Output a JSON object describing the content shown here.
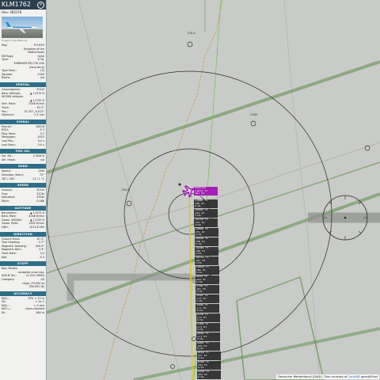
{
  "sidebar": {
    "callsign": "KLM1762",
    "hex_label": "Hex: 4852F8",
    "photo_caption": "Image © Jan Mazurek",
    "info_rows": [
      {
        "k": "Reg:",
        "v": "PH-EXH"
      },
      {
        "k": "",
        "v": "Kingdom of the"
      },
      {
        "k": "",
        "v": "Netherlands"
      },
      {
        "k": "DB flags:",
        "v": "none"
      },
      {
        "k": "Type:",
        "v": "E75L"
      },
      {
        "k": "",
        "v": "EMBRAER ERJ-170-200"
      },
      {
        "k": "",
        "v": "(long wing)"
      },
      {
        "k": "Type Desc.:",
        "v": "L2J"
      },
      {
        "k": "Squawk:",
        "v": "1000"
      },
      {
        "k": "Route:",
        "v": "n/a"
      }
    ],
    "sections": [
      {
        "title": "SPATIAL",
        "rows": [
          {
            "k": "Groundspeed:",
            "v": "301kt"
          },
          {
            "k": "Baro. Altitude:",
            "v": "▲ 11075 ft"
          },
          {
            "k": "WGS84 altitude:",
            "v": ""
          },
          {
            "k": "",
            "v": "▲ 11750 ft"
          },
          {
            "k": "Vert. Rate:",
            "v": "2048 ft/min"
          },
          {
            "k": "Track:",
            "v": "67.3°"
          },
          {
            "k": "Pos.:",
            "v": "51.207, 6.012°"
          },
          {
            "k": "Distance:",
            "v": "2.3 nmi"
          }
        ]
      },
      {
        "title": "SIGNAL",
        "rows": [
          {
            "k": "Source:",
            "v": "ADS-B"
          },
          {
            "k": "RSSI:",
            "v": "-5.2"
          },
          {
            "k": "Msg. Rate:",
            "v": "5.2"
          },
          {
            "k": "Messages:",
            "v": "2452"
          },
          {
            "k": "Last Pos.:",
            "v": "0.0 s"
          },
          {
            "k": "Last Seen:",
            "v": "0.0 s"
          }
        ]
      },
      {
        "title": "FMS SEL",
        "rows": [
          {
            "k": "Sel. Alt.:",
            "v": "17008 ft"
          },
          {
            "k": "Sel. Head.:",
            "v": "n/a"
          }
        ]
      },
      {
        "title": "WIND",
        "rows": [
          {
            "k": "Speed:",
            "v": "29kt"
          },
          {
            "k": "Direction (from):",
            "v": "73°"
          },
          {
            "k": "TAT / OAT:",
            "v": "11 / 1 °C"
          }
        ]
      },
      {
        "title": "SPEED",
        "rows": [
          {
            "k": "Ground:",
            "v": "301kt"
          },
          {
            "k": "True:",
            "v": "312kt"
          },
          {
            "k": "Indicated:",
            "v": "255kt"
          },
          {
            "k": "Mach:",
            "v": "0.486"
          }
        ]
      },
      {
        "title": "ALTITUDE",
        "rows": [
          {
            "k": "Barometric:",
            "v": "▲ 11075 ft"
          },
          {
            "k": "Baro. Rate:",
            "v": "2048 ft/min"
          },
          {
            "k": "Geom. WGS84:",
            "v": "▲ 11750 ft"
          },
          {
            "k": "Geom. Rate:",
            "v": "1632 ft/min"
          },
          {
            "k": "QNH:",
            "v": "1013.6 hPa"
          }
        ]
      },
      {
        "title": "DIRECTION",
        "rows": [
          {
            "k": "Ground Track:",
            "v": "67.3°"
          },
          {
            "k": "True Heading:",
            "v": "2.7°"
          },
          {
            "k": "Magnetic Heading:",
            "v": "359.3°"
          },
          {
            "k": "Magnetic Decl.:",
            "v": "3.4°"
          },
          {
            "k": "Track Rate:",
            "v": "0.0"
          },
          {
            "k": "Roll:",
            "v": "-0.3"
          }
        ]
      },
      {
        "title": "STUFF",
        "rows": [
          {
            "k": "Nav. Modes:",
            "v": ""
          },
          {
            "k": "",
            "v": "autopilot,vnav,lnav"
          },
          {
            "k": "ADS-B Ver.:",
            "v": "v2 (DO-260B)"
          },
          {
            "k": "Category:",
            "v": "A3"
          },
          {
            "k": "",
            "v": "Large (75,000 to"
          },
          {
            "k": "",
            "v": "300,000 lb)"
          }
        ]
      },
      {
        "title": "ACCURACY",
        "rows": [
          {
            "k": "NACₚ:",
            "v": "EPU < 10 m"
          },
          {
            "k": "SIL:",
            "v": "< 1e-7"
          },
          {
            "k": "NACᵥ:",
            "v": "< 3 m/s"
          },
          {
            "k": "NICᵇₐᵣₒ:",
            "v": "cross-checked"
          },
          {
            "k": "Rc:",
            "v": "186 m"
          }
        ]
      }
    ]
  },
  "map": {
    "attribution_prefix": "Deutscher Wetterdienst (DWD). Tiles courtesy of",
    "attribution_link": "CartoDB",
    "attribution_suffix": "openAIP.net",
    "selected_label": [
      "KLM1762",
      "11075 ft",
      "301 kt",
      "E75L"
    ],
    "trail_labels": [
      [
        "11000 ft",
        "296 kt",
        "E75L"
      ],
      [
        "10900 ft",
        "294 kt",
        "E75L"
      ],
      [
        "10750 ft",
        "293 kt",
        "E75L"
      ],
      [
        "10600 ft",
        "291 kt",
        "E75L"
      ],
      [
        "10450 ft",
        "290 kt",
        "E75L"
      ],
      [
        "10300 ft",
        "288 kt",
        "E75L"
      ],
      [
        "10150 ft",
        "287 kt",
        "E75L"
      ],
      [
        "10000 ft",
        "285 kt",
        "E75L"
      ],
      [
        "9850 ft",
        "283 kt",
        "E75L"
      ],
      [
        "9700 ft",
        "281 kt",
        "E75L"
      ],
      [
        "9550 ft",
        "279 kt",
        "E75L"
      ],
      [
        "9400 ft",
        "277 kt",
        "E75L"
      ],
      [
        "9250 ft",
        "275 kt",
        "E75L"
      ],
      [
        "9100 ft",
        "273 kt",
        "E75L"
      ],
      [
        "8950 ft",
        "271 kt",
        "E75L"
      ],
      [
        "8800 ft",
        "269 kt",
        "E75L"
      ],
      [
        "8650 ft",
        "267 kt",
        "E75L"
      ],
      [
        "8500 ft",
        "265 kt",
        "E75L"
      ],
      [
        "8350 ft",
        "263 kt",
        "E75L"
      ]
    ],
    "colors": {
      "selected": "#a012b4",
      "airspace": "#5a8d47",
      "track": "#d4c92a",
      "route": "#7dc061",
      "border": "#c79a4a"
    }
  }
}
